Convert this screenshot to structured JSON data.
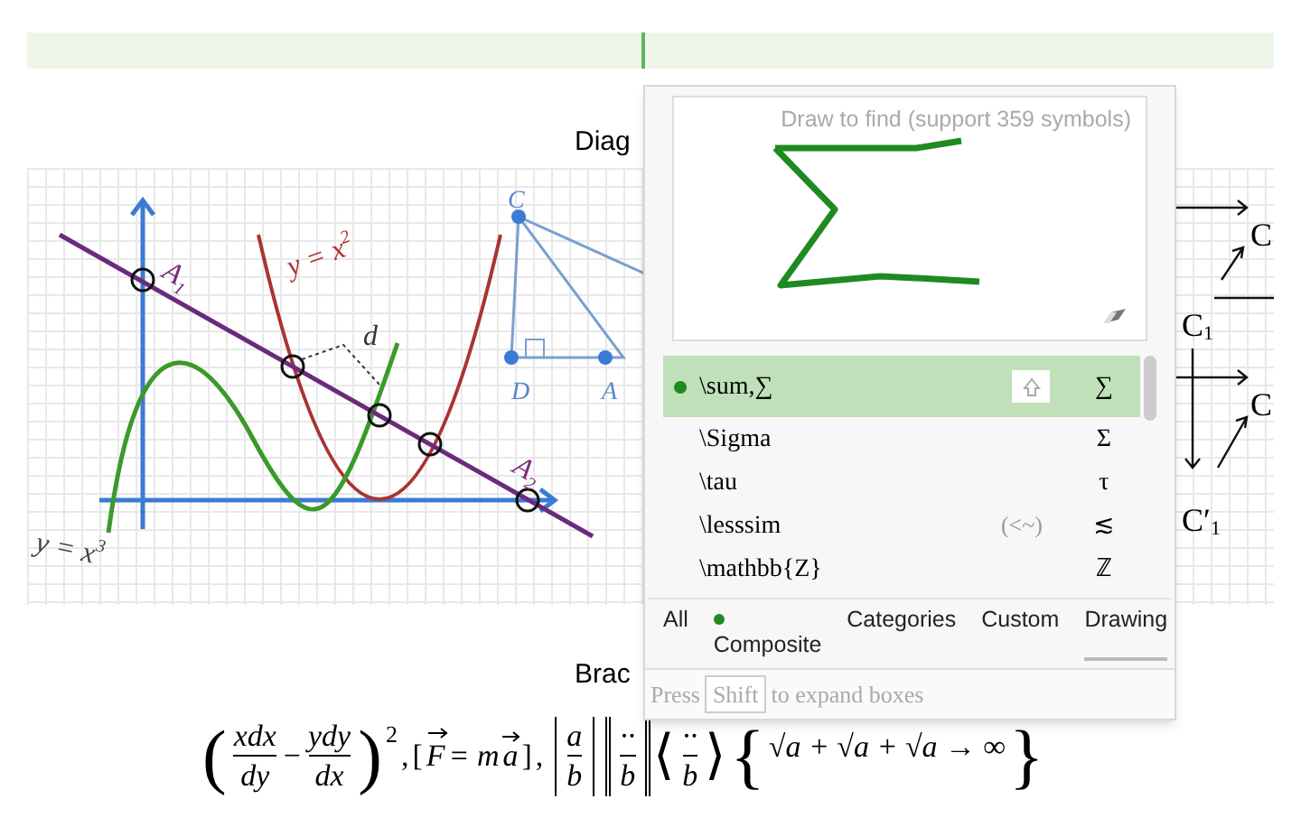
{
  "graph_panel": {
    "labels": [
      {
        "kind": "A1",
        "text": "A",
        "sub": "1"
      },
      {
        "kind": "parabola",
        "text": "y = x",
        "sup": "2"
      },
      {
        "kind": "d",
        "text": "d"
      },
      {
        "kind": "A2",
        "text": "A",
        "sub": "2"
      },
      {
        "kind": "cubic",
        "text": "y = x",
        "sup": "3"
      }
    ],
    "triangle_labels": [
      "C",
      "D",
      "A"
    ]
  },
  "headings": [
    "Diag",
    "Brac"
  ],
  "right_diagram": {
    "labels": [
      {
        "text": "C"
      },
      {
        "text": "C",
        "mark": "1"
      },
      {
        "text": "C"
      },
      {
        "text": "C′",
        "mark": "1"
      }
    ]
  },
  "symbol_finder": {
    "canvas_placeholder": "Draw to find (support 359 symbols)",
    "results": [
      {
        "command": "\\sum,∑",
        "symbol": "∑",
        "selected": true
      },
      {
        "command": "\\Sigma",
        "symbol": "Σ",
        "selected": false
      },
      {
        "command": "\\tau",
        "symbol": "τ",
        "selected": false
      },
      {
        "command": "\\lesssim",
        "alias": "(<~)",
        "symbol": "≲",
        "selected": false
      },
      {
        "command": "\\mathbb{Z}",
        "symbol": "ℤ",
        "selected": false
      }
    ],
    "tabs": [
      {
        "label": "All",
        "dot": false,
        "selected": false
      },
      {
        "label": "Composite",
        "dot": true,
        "selected": false
      },
      {
        "label": "Categories",
        "dot": false,
        "selected": false
      },
      {
        "label": "Custom",
        "dot": false,
        "selected": false
      },
      {
        "label": "Drawing",
        "dot": false,
        "selected": true
      }
    ],
    "hint": {
      "before": "Press",
      "key": "Shift",
      "after": "to expand boxes"
    }
  },
  "formula": {
    "paren_open": "(",
    "paren_close": ")",
    "angle_open": "⟨",
    "angle_close": "⟩",
    "brace_open": "{",
    "brace_close": "}",
    "frac1": [
      "xdx",
      "dy"
    ],
    "minus": "−",
    "frac2": [
      "ydy",
      "dx"
    ],
    "power": "2",
    "comma": ",",
    "vec_eq": {
      "open": "[",
      "lhs": "F",
      "middle": "= m",
      "rhs": "a",
      "close": "]"
    },
    "abs_frac": [
      "a",
      "b"
    ],
    "norm_frac": [
      "··",
      "b"
    ],
    "angle_frac": [
      "··",
      "b"
    ],
    "roots": "√a + √a + √a → ∞"
  }
}
